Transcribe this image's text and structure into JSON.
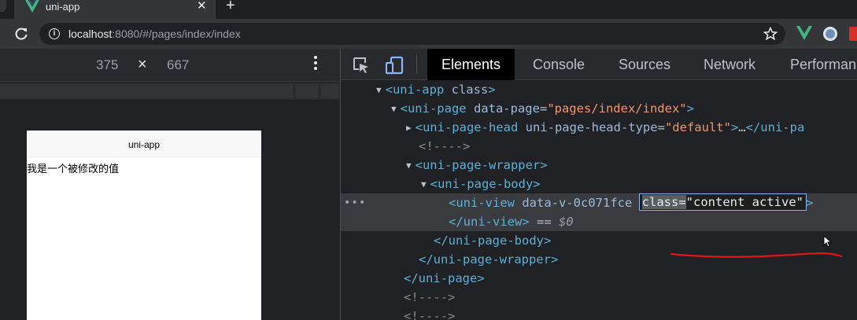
{
  "browser": {
    "tab_title": "uni-app",
    "tab_close": "✕",
    "new_tab": "+",
    "url_host": "localhost",
    "url_rest": ":8080/#/pages/index/index"
  },
  "device_toolbar": {
    "width": "375",
    "times": "×",
    "height": "667"
  },
  "preview": {
    "nav_title": "uni-app",
    "content_text": "我是一个被修改的值"
  },
  "devtools": {
    "tabs": [
      {
        "label": "Elements",
        "active": true
      },
      {
        "label": "Console",
        "active": false
      },
      {
        "label": "Sources",
        "active": false
      },
      {
        "label": "Network",
        "active": false
      },
      {
        "label": "Performan",
        "active": false
      }
    ],
    "tree": {
      "r1_tag": "<uni-app",
      "r1_attr": "class",
      "r1_close": ">",
      "r2_tag": "<uni-page",
      "r2_attr": "data-page",
      "r2_val": "\"pages/index/index\"",
      "r2_close": ">",
      "r3_tag": "<uni-page-head",
      "r3_attr": "uni-page-head-type",
      "r3_val": "\"default\"",
      "r3_close": ">",
      "r3_ellipsis": "…",
      "r3_end": "</uni-pa",
      "r4_comment": "<!---->",
      "r5_tag": "<uni-page-wrapper>",
      "r6_tag": "<uni-page-body>",
      "r7_tag": "<uni-view",
      "r7_attr": "data-v-0c071fce",
      "r7_edit_name": "class=",
      "r7_edit_val": "\"content active\"",
      "r7_close": ">",
      "r8_tag": "</uni-view>",
      "r8_eq": " == ",
      "r8_dollar": "$0",
      "r9_tag": "</uni-page-body>",
      "r10_tag": "</uni-page-wrapper>",
      "r11_tag": "</uni-page>",
      "r12_comment": "<!---->",
      "r13_comment": "<!---->",
      "more": "•••"
    }
  },
  "colors": {
    "annotation": "#e0161b",
    "vue_green": "#41b883",
    "tag": "#5db0d7",
    "value": "#f29766"
  }
}
